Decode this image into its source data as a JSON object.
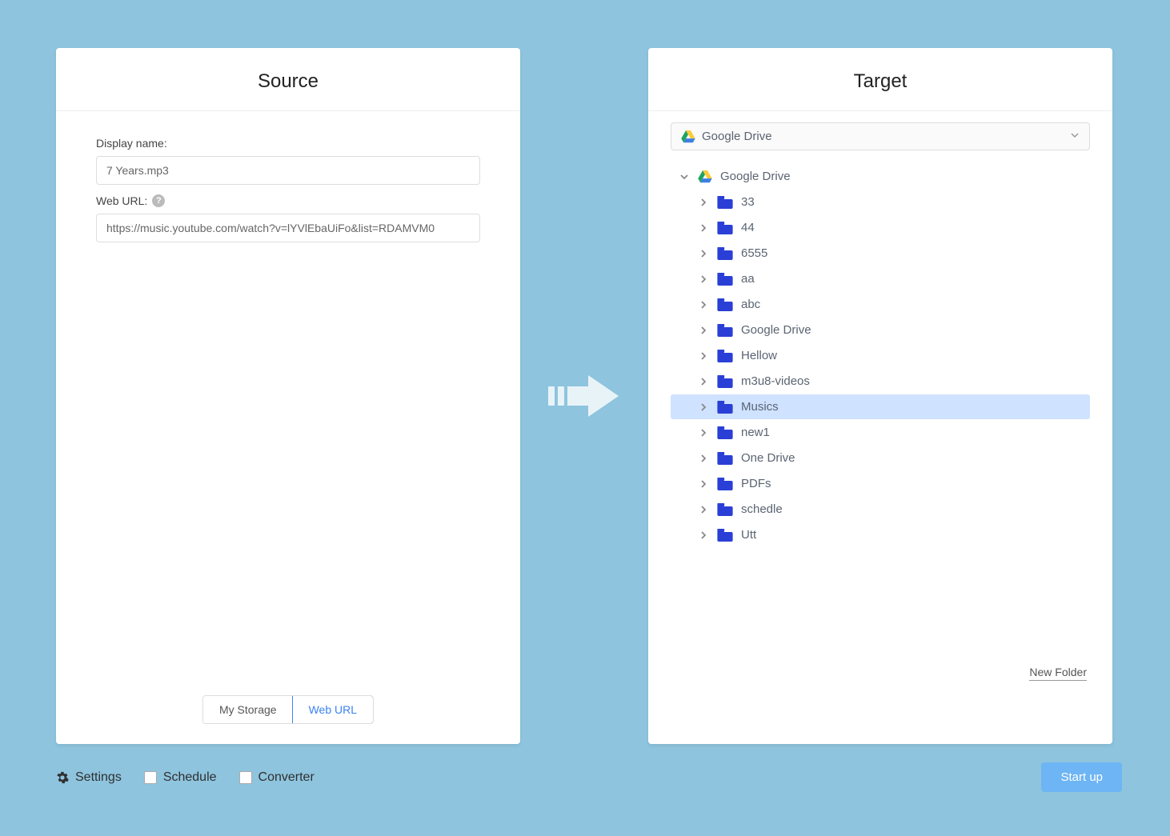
{
  "source": {
    "title": "Source",
    "display_name_label": "Display name:",
    "display_name_value": "7 Years.mp3",
    "web_url_label": "Web URL:",
    "web_url_value": "https://music.youtube.com/watch?v=lYVlEbaUiFo&list=RDAMVM0",
    "tabs": {
      "my_storage": "My Storage",
      "web_url": "Web URL"
    },
    "active_tab": "web_url"
  },
  "target": {
    "title": "Target",
    "selected_drive": "Google Drive",
    "root_label": "Google Drive",
    "folders": [
      {
        "name": "33",
        "selected": false
      },
      {
        "name": "44",
        "selected": false
      },
      {
        "name": "6555",
        "selected": false
      },
      {
        "name": "aa",
        "selected": false
      },
      {
        "name": "abc",
        "selected": false
      },
      {
        "name": "Google Drive",
        "selected": false
      },
      {
        "name": "Hellow",
        "selected": false
      },
      {
        "name": "m3u8-videos",
        "selected": false
      },
      {
        "name": "Musics",
        "selected": true
      },
      {
        "name": "new1",
        "selected": false
      },
      {
        "name": "One Drive",
        "selected": false
      },
      {
        "name": "PDFs",
        "selected": false
      },
      {
        "name": "schedle",
        "selected": false
      },
      {
        "name": "Utt",
        "selected": false
      }
    ],
    "new_folder_label": "New Folder"
  },
  "footer": {
    "settings": "Settings",
    "schedule": "Schedule",
    "converter": "Converter",
    "start": "Start up"
  }
}
